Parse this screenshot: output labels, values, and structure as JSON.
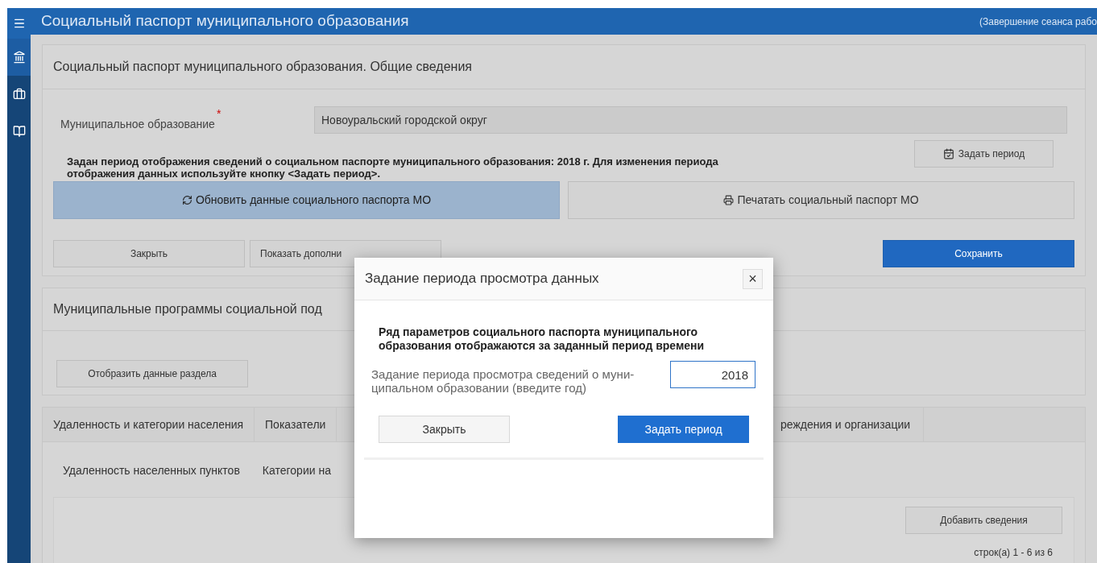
{
  "header": {
    "title": "Социальный паспорт муниципального образования",
    "session_link": "(Завершение сеанса рабо"
  },
  "sidebar": {
    "items": [
      {
        "kind": "bank",
        "selected": true
      },
      {
        "kind": "briefcase",
        "selected": false
      },
      {
        "kind": "book",
        "selected": false
      }
    ]
  },
  "general_panel": {
    "title": "Социальный паспорт муниципального образования. Общие сведения",
    "field": {
      "label": "Муниципальное образование",
      "required_mark": "*",
      "value": "Новоуральский городской округ"
    },
    "notice": "Задан период отображения сведений о социальном паспорте муниципального образования: 2018 г. Для изменения периода отображения данных используйте кнопку <Задать период>.",
    "period_button": "Задать период",
    "action_buttons": [
      {
        "label": "Обновить данные социального паспорта МО",
        "kind": "refresh"
      },
      {
        "label": "Печатать социальный паспорт МО",
        "kind": "print"
      }
    ],
    "bottom_buttons": [
      {
        "label": "Закрыть",
        "kind": "default"
      },
      {
        "label": "Показать дополни",
        "kind": "default"
      },
      {
        "label": "Сохранить",
        "kind": "primary"
      }
    ]
  },
  "programs_panel": {
    "title": "Муниципальные программы социальной под",
    "button": "Отобразить данные раздела"
  },
  "tabs": [
    {
      "label": "Удаленность и категории населения"
    },
    {
      "label": "Показатели"
    },
    {
      "label": "реждения и организации"
    }
  ],
  "subtabs": [
    {
      "label": "Удаленность населенных пунктов"
    },
    {
      "label": "Категории на"
    }
  ],
  "table_panel": {
    "add_button": "Добавить сведения",
    "pager": "строк(а) 1 - 6 из 6"
  },
  "dialog": {
    "title": "Задание периода просмотра данных",
    "close": "×",
    "intro": "Ряд параметров социального паспорта муниципального образования отображаются за заданный период времени",
    "field_label": "Задание периода просмотра сведений о муни-ципальном образовании (введите год)",
    "year": "2018",
    "buttons": [
      {
        "label": "Закрыть",
        "kind": "default"
      },
      {
        "label": "Задать период",
        "kind": "primary"
      }
    ]
  }
}
